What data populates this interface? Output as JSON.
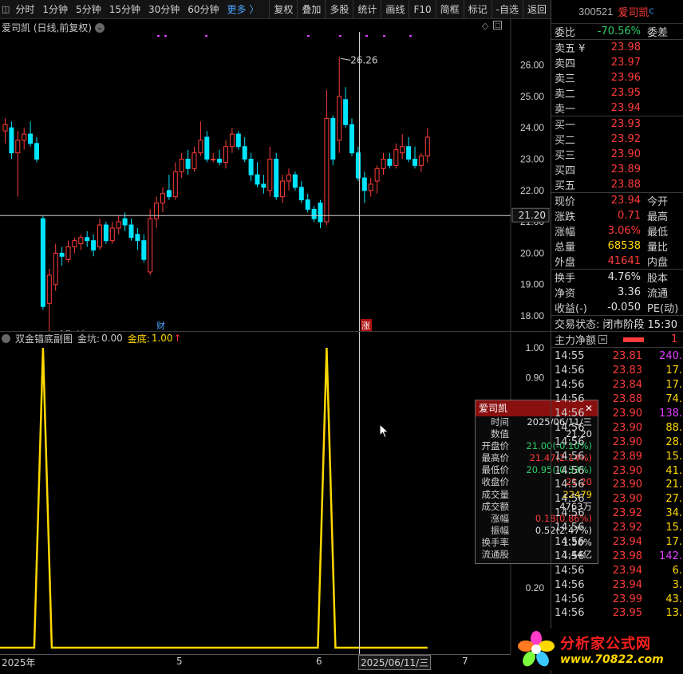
{
  "toolbar": {
    "left_items": [
      "分时",
      "1分钟",
      "5分钟",
      "15分钟",
      "30分钟",
      "60分钟"
    ],
    "more": "更多 〉",
    "right_items": [
      "复权",
      "叠加",
      "多股",
      "统计",
      "画线",
      "F10",
      "简框",
      "标记",
      "-自选",
      "返回"
    ]
  },
  "main_chart": {
    "title": "爱司凯 (日线,前复权)",
    "price_ticks": [
      "26.00",
      "25.00",
      "24.00",
      "23.00",
      "22.00",
      "21.00",
      "20.00",
      "19.00",
      "18.00"
    ],
    "crosshair_price": "21.20",
    "high_marker": "26.26",
    "low_marker": "17.40",
    "cai_marker": "财",
    "zhang_marker": "涨",
    "candles": [
      [
        23.9,
        24.3,
        23.5,
        24.1
      ],
      [
        24.0,
        24.2,
        23.0,
        23.2
      ],
      [
        23.2,
        23.9,
        21.8,
        23.6
      ],
      [
        23.6,
        24.0,
        23.3,
        23.8
      ],
      [
        23.8,
        24.2,
        23.4,
        23.5
      ],
      [
        23.5,
        23.7,
        22.9,
        23.0
      ],
      [
        21.1,
        21.2,
        18.2,
        18.3
      ],
      [
        18.4,
        19.5,
        17.4,
        19.3
      ],
      [
        19.0,
        20.3,
        18.8,
        20.0
      ],
      [
        20.0,
        20.2,
        19.6,
        19.9
      ],
      [
        19.8,
        20.4,
        19.7,
        20.2
      ],
      [
        20.2,
        20.5,
        20.0,
        20.4
      ],
      [
        20.3,
        20.6,
        20.1,
        20.5
      ],
      [
        20.5,
        20.7,
        20.2,
        20.4
      ],
      [
        20.4,
        20.6,
        19.9,
        20.1
      ],
      [
        20.2,
        21.1,
        20.1,
        20.9
      ],
      [
        20.9,
        21.0,
        20.3,
        20.4
      ],
      [
        20.4,
        21.0,
        20.3,
        20.8
      ],
      [
        20.8,
        21.2,
        20.6,
        21.0
      ],
      [
        21.1,
        21.3,
        20.7,
        20.9
      ],
      [
        20.9,
        21.1,
        20.4,
        20.5
      ],
      [
        20.6,
        20.8,
        20.1,
        20.4
      ],
      [
        20.4,
        20.6,
        19.7,
        19.8
      ],
      [
        19.4,
        21.4,
        19.3,
        21.1
      ],
      [
        21.1,
        21.8,
        20.8,
        21.6
      ],
      [
        21.6,
        22.1,
        21.3,
        21.9
      ],
      [
        22.0,
        22.5,
        21.7,
        21.8
      ],
      [
        21.8,
        22.9,
        21.7,
        22.6
      ],
      [
        22.6,
        23.2,
        22.4,
        23.0
      ],
      [
        23.0,
        23.3,
        22.5,
        22.7
      ],
      [
        22.7,
        23.4,
        22.6,
        23.2
      ],
      [
        23.2,
        24.2,
        23.1,
        23.6
      ],
      [
        23.7,
        23.9,
        22.9,
        23.0
      ],
      [
        23.0,
        23.2,
        22.9,
        23.0
      ],
      [
        23.0,
        23.3,
        22.8,
        22.9
      ],
      [
        22.9,
        23.6,
        22.7,
        23.4
      ],
      [
        23.4,
        24.0,
        23.2,
        23.8
      ],
      [
        23.8,
        23.9,
        23.3,
        23.4
      ],
      [
        23.4,
        23.7,
        22.9,
        23.0
      ],
      [
        23.0,
        23.2,
        22.3,
        22.5
      ],
      [
        22.5,
        22.9,
        22.1,
        22.2
      ],
      [
        22.2,
        22.5,
        21.9,
        22.1
      ],
      [
        22.0,
        23.4,
        21.8,
        23.0
      ],
      [
        23.0,
        23.2,
        21.7,
        21.8
      ],
      [
        21.8,
        22.5,
        21.6,
        22.3
      ],
      [
        22.3,
        22.7,
        22.0,
        22.5
      ],
      [
        22.5,
        22.6,
        22.0,
        22.1
      ],
      [
        22.1,
        22.3,
        21.6,
        21.7
      ],
      [
        21.7,
        21.9,
        21.3,
        21.4
      ],
      [
        21.4,
        21.5,
        21.0,
        21.1
      ],
      [
        21.6,
        21.7,
        20.8,
        21.0
      ],
      [
        21.0,
        25.2,
        20.9,
        24.3
      ],
      [
        24.3,
        24.4,
        22.8,
        23.0
      ],
      [
        23.6,
        26.26,
        23.2,
        25.0
      ],
      [
        24.9,
        25.3,
        24.0,
        24.1
      ],
      [
        24.1,
        24.3,
        23.1,
        23.2
      ],
      [
        23.2,
        23.4,
        22.3,
        22.4
      ],
      [
        22.4,
        22.6,
        21.6,
        22.0
      ],
      [
        22.0,
        22.4,
        21.8,
        22.2
      ],
      [
        22.3,
        22.8,
        21.9,
        22.7
      ],
      [
        22.7,
        23.2,
        22.5,
        23.0
      ],
      [
        23.0,
        23.2,
        22.7,
        22.8
      ],
      [
        22.8,
        23.5,
        22.7,
        23.3
      ],
      [
        23.2,
        23.8,
        23.0,
        23.4
      ],
      [
        23.4,
        23.7,
        22.9,
        23.0
      ],
      [
        23.0,
        23.4,
        22.7,
        22.8
      ],
      [
        22.8,
        23.2,
        22.6,
        23.1
      ],
      [
        23.1,
        24.0,
        22.9,
        23.7
      ]
    ]
  },
  "sub_chart": {
    "title": "双金锚底副图",
    "jinkeng_label": "金坑:",
    "jinkeng_value": "0.00",
    "jindi_label": "金底:",
    "jindi_value": "1.00",
    "arrow": "↑",
    "y_ticks": [
      "1.00",
      "0.90",
      "0.20"
    ],
    "peaks_candle_index": [
      6,
      51
    ]
  },
  "date_axis": {
    "labels": [
      "2025年",
      "5",
      "6",
      "2025/06/11/三",
      "7"
    ]
  },
  "tooltip": {
    "title": "爱司凯",
    "close": "✕",
    "rows": [
      {
        "k": "时间",
        "v": "2025/06/11/三",
        "c": "white"
      },
      {
        "k": "数值",
        "v": "21.20",
        "c": "white"
      },
      {
        "k": "开盘价",
        "v": "21.00(-0.10%)",
        "c": "down"
      },
      {
        "k": "最高价",
        "v": "21.47(2.14%)",
        "c": "up"
      },
      {
        "k": "最低价",
        "v": "20.95(-0.33%)",
        "c": "down"
      },
      {
        "k": "收盘价",
        "v": "21.20",
        "c": "up"
      },
      {
        "k": "成交量",
        "v": "22479",
        "c": "yellow"
      },
      {
        "k": "成交额",
        "v": "4763万",
        "c": "white"
      },
      {
        "k": "涨幅",
        "v": "0.18(0.86%)",
        "c": "up"
      },
      {
        "k": "振幅",
        "v": "0.52(2.47%)",
        "c": "white"
      },
      {
        "k": "换手率",
        "v": "1.56%",
        "c": "white"
      },
      {
        "k": "流通股",
        "v": "1.44亿",
        "c": "white"
      }
    ]
  },
  "quote": {
    "code": "300521",
    "name": "爱司凯",
    "sup": "C",
    "weibi_label": "委比",
    "weibi_value": "-70.56%",
    "weicha_label": "委差",
    "asks": [
      {
        "label": "卖五 ¥",
        "price": "23.98"
      },
      {
        "label": "卖四",
        "price": "23.97"
      },
      {
        "label": "卖三",
        "price": "23.96"
      },
      {
        "label": "卖二",
        "price": "23.95"
      },
      {
        "label": "卖一",
        "price": "23.94"
      }
    ],
    "bids": [
      {
        "label": "买一",
        "price": "23.93"
      },
      {
        "label": "买二",
        "price": "23.92"
      },
      {
        "label": "买三",
        "price": "23.90"
      },
      {
        "label": "买四",
        "price": "23.89"
      },
      {
        "label": "买五",
        "price": "23.88"
      }
    ],
    "stats1": [
      {
        "label": "现价",
        "value": "23.94",
        "c": "up",
        "label2": "今开"
      },
      {
        "label": "涨跌",
        "value": "0.71",
        "c": "up",
        "label2": "最高"
      },
      {
        "label": "涨幅",
        "value": "3.06%",
        "c": "up",
        "label2": "最低"
      },
      {
        "label": "总量",
        "value": "68538",
        "c": "yellow",
        "label2": "量比"
      },
      {
        "label": "外盘",
        "value": "41641",
        "c": "up",
        "label2": "内盘"
      }
    ],
    "stats2": [
      {
        "label": "换手",
        "value": "4.76%",
        "c": "white",
        "label2": "股本"
      },
      {
        "label": "净资",
        "value": "3.36",
        "c": "white",
        "label2": "流通"
      },
      {
        "label": "收益(-)",
        "value": "-0.050",
        "c": "white",
        "label2": "PE(动)"
      }
    ],
    "trade_state_label": "交易状态:",
    "trade_state_value": "闭市阶段 15:30",
    "main_net_label": "主力净额",
    "main_net_value": "1"
  },
  "ticks": [
    {
      "t": "14:55",
      "p": "23.81",
      "v": "240.",
      "vc": "purple"
    },
    {
      "t": "14:56",
      "p": "23.83",
      "v": "17.",
      "vc": "yellow"
    },
    {
      "t": "14:56",
      "p": "23.84",
      "v": "17.",
      "vc": "yellow"
    },
    {
      "t": "14:56",
      "p": "23.88",
      "v": "74.",
      "vc": "yellow"
    },
    {
      "t": "14:56",
      "p": "23.90",
      "v": "138.",
      "vc": "purple"
    },
    {
      "t": "14:56",
      "p": "23.90",
      "v": "88.",
      "vc": "yellow"
    },
    {
      "t": "14:56",
      "p": "23.90",
      "v": "28.",
      "vc": "yellow"
    },
    {
      "t": "14:56",
      "p": "23.89",
      "v": "15.",
      "vc": "yellow"
    },
    {
      "t": "14:56",
      "p": "23.90",
      "v": "41.",
      "vc": "yellow"
    },
    {
      "t": "14:56",
      "p": "23.90",
      "v": "21.",
      "vc": "yellow"
    },
    {
      "t": "14:56",
      "p": "23.90",
      "v": "27.",
      "vc": "yellow"
    },
    {
      "t": "14:56",
      "p": "23.92",
      "v": "34.",
      "vc": "yellow"
    },
    {
      "t": "14:56",
      "p": "23.92",
      "v": "15.",
      "vc": "yellow"
    },
    {
      "t": "14:56",
      "p": "23.94",
      "v": "17.",
      "vc": "yellow"
    },
    {
      "t": "14:56",
      "p": "23.98",
      "v": "142.",
      "vc": "purple"
    },
    {
      "t": "14:56",
      "p": "23.94",
      "v": "6.",
      "vc": "yellow"
    },
    {
      "t": "14:56",
      "p": "23.94",
      "v": "3.",
      "vc": "yellow"
    },
    {
      "t": "14:56",
      "p": "23.99",
      "v": "43.",
      "vc": "yellow"
    },
    {
      "t": "14:56",
      "p": "23.95",
      "v": "13.",
      "vc": "yellow"
    }
  ],
  "logo": {
    "line1": "分析家公式网",
    "line2": "www.70822.com"
  },
  "colors": {
    "up": "#ff3b3b",
    "down": "#2fd06a",
    "cyan": "#00e5ff",
    "gold": "#ffd800",
    "bg": "#000000"
  }
}
